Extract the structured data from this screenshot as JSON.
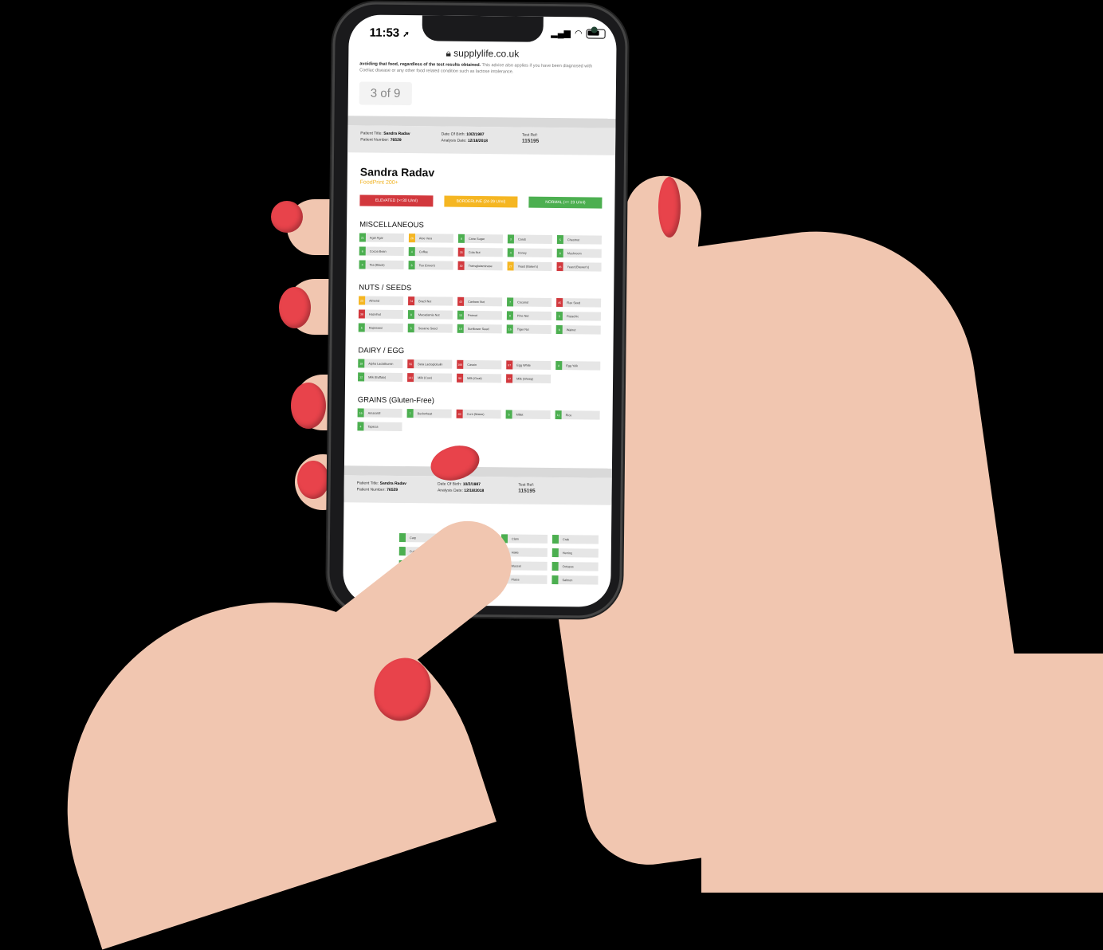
{
  "status_bar": {
    "time": "11:53",
    "location_glyph": "➚",
    "signal_icon": "signal-icon",
    "wifi_icon": "wifi-icon",
    "battery_icon": "battery-icon"
  },
  "browser": {
    "url": "supplylife.co.uk",
    "lock_icon": "lock-icon"
  },
  "advice": {
    "bold": "avoiding that food, regardless of the test results obtained.",
    "rest": " This advice also applies if you have been diagnosed with Coeliac disease or any other food related condition such as lactose intolerance."
  },
  "pager": "3 of 9",
  "header": {
    "title_label": "Patient Title:",
    "title_value": "Sandra Radav",
    "number_label": "Patient Number:",
    "number_value": "76529",
    "dob_label": "Date Of Birth:",
    "dob_value": "10/2/1987",
    "analysis_label": "Analysis Date:",
    "analysis_value": "12/18/2018",
    "ref_label": "Test Ref:",
    "ref_value": "115195"
  },
  "patient_name": "Sandra Radav",
  "product": "FoodPrint 200+",
  "legend": {
    "elevated": "ELEVATED (>=30 U/ml)",
    "borderline": "BORDERLINE (24-29 U/ml)",
    "normal": "NORMAL (<= 23 U/ml)"
  },
  "colors": {
    "elevated": "#d2383d",
    "borderline": "#f5b622",
    "normal": "#4caf50"
  },
  "sections": [
    {
      "title": "MISCELLANEOUS",
      "items": [
        {
          "v": "21",
          "n": "Agar Agar",
          "s": "g"
        },
        {
          "v": "26",
          "n": "Aloe Vera",
          "s": "y"
        },
        {
          "v": "8",
          "n": "Cane Sugar",
          "s": "g"
        },
        {
          "v": "3",
          "n": "Carob",
          "s": "g"
        },
        {
          "v": "5",
          "n": "Chestnut",
          "s": "g"
        },
        {
          "v": "6",
          "n": "Cocoa Bean",
          "s": "g"
        },
        {
          "v": "4",
          "n": "Coffee",
          "s": "g"
        },
        {
          "v": "35",
          "n": "Cola Nut",
          "s": "r"
        },
        {
          "v": "4",
          "n": "Honey",
          "s": "g"
        },
        {
          "v": "8",
          "n": "Mushroom",
          "s": "g"
        },
        {
          "v": "4",
          "n": "Tea (Black)",
          "s": "g"
        },
        {
          "v": "6",
          "n": "Tea (Green)",
          "s": "g"
        },
        {
          "v": "30",
          "n": "Transglutaminase",
          "s": "r"
        },
        {
          "v": "27",
          "n": "Yeast (Baker's)",
          "s": "y"
        },
        {
          "v": "46",
          "n": "Yeast (Brewer's)",
          "s": "r"
        }
      ]
    },
    {
      "title": "NUTS / SEEDS",
      "items": [
        {
          "v": "25",
          "n": "Almond",
          "s": "y"
        },
        {
          "v": "74",
          "n": "Brazil Nut",
          "s": "r"
        },
        {
          "v": "43",
          "n": "Cashew Nut",
          "s": "r"
        },
        {
          "v": "7",
          "n": "Coconut",
          "s": "g"
        },
        {
          "v": "45",
          "n": "Flax Seed",
          "s": "r"
        },
        {
          "v": "38",
          "n": "Hazelnut",
          "s": "r"
        },
        {
          "v": "8",
          "n": "Macadamia Nut",
          "s": "g"
        },
        {
          "v": "15",
          "n": "Peanut",
          "s": "g"
        },
        {
          "v": "9",
          "n": "Pine Nut",
          "s": "g"
        },
        {
          "v": "5",
          "n": "Pistachio",
          "s": "g"
        },
        {
          "v": "5",
          "n": "Rapeseed",
          "s": "g"
        },
        {
          "v": "5",
          "n": "Sesame Seed",
          "s": "g"
        },
        {
          "v": "18",
          "n": "Sunflower Seed",
          "s": "g"
        },
        {
          "v": "16",
          "n": "Tiger Nut",
          "s": "g"
        },
        {
          "v": "6",
          "n": "Walnut",
          "s": "g"
        }
      ]
    },
    {
      "title": "DAIRY / EGG",
      "items": [
        {
          "v": "18",
          "n": "Alpha Lactalbumin",
          "s": "g"
        },
        {
          "v": "55",
          "n": "Beta Lactoglobulin",
          "s": "r"
        },
        {
          "v": "166",
          "n": "Casein",
          "s": "r"
        },
        {
          "v": "87",
          "n": "Egg White",
          "s": "r"
        },
        {
          "v": "8",
          "n": "Egg Yolk",
          "s": "g"
        },
        {
          "v": "12",
          "n": "Milk (Buffalo)",
          "s": "g"
        },
        {
          "v": "141",
          "n": "Milk (Cow)",
          "s": "r"
        },
        {
          "v": "96",
          "n": "Milk (Goat)",
          "s": "r"
        },
        {
          "v": "47",
          "n": "Milk (Sheep)",
          "s": "r"
        }
      ]
    },
    {
      "title": "GRAINS (Gluten-Free)",
      "items": [
        {
          "v": "16",
          "n": "Amaranth",
          "s": "g"
        },
        {
          "v": "7",
          "n": "Buckwheat",
          "s": "g"
        },
        {
          "v": "40",
          "n": "Corn (Maize)",
          "s": "r"
        },
        {
          "v": "5",
          "n": "Millet",
          "s": "g"
        },
        {
          "v": "11",
          "n": "Rice",
          "s": "g"
        },
        {
          "v": "4",
          "n": "Tapioca",
          "s": "g"
        }
      ]
    }
  ],
  "next_page_items": [
    {
      "v": "",
      "n": "Carp",
      "s": "g"
    },
    {
      "v": "",
      "n": "Caviar",
      "s": "g"
    },
    {
      "v": "",
      "n": "Clam",
      "s": "g"
    },
    {
      "v": "",
      "n": "Crab",
      "s": "g"
    },
    {
      "v": "",
      "n": "Cuttlefish",
      "s": "g"
    },
    {
      "v": "",
      "n": "Eel",
      "s": "g"
    },
    {
      "v": "",
      "n": "Hake",
      "s": "g"
    },
    {
      "v": "",
      "n": "Herring",
      "s": "g"
    },
    {
      "v": "",
      "n": "Lobster",
      "s": "g"
    },
    {
      "v": "",
      "n": "Mackerel",
      "s": "g"
    },
    {
      "v": "",
      "n": "Mussel",
      "s": "g"
    },
    {
      "v": "",
      "n": "Octopus",
      "s": "g"
    },
    {
      "v": "",
      "n": "Oyster",
      "s": "g"
    },
    {
      "v": "",
      "n": "Perch",
      "s": "g"
    },
    {
      "v": "",
      "n": "Plaice",
      "s": "g"
    },
    {
      "v": "",
      "n": "Salmon",
      "s": "g"
    },
    {
      "v": "",
      "n": "Sardine",
      "s": "g"
    },
    {
      "v": "",
      "n": "Scallop",
      "s": "g"
    }
  ]
}
